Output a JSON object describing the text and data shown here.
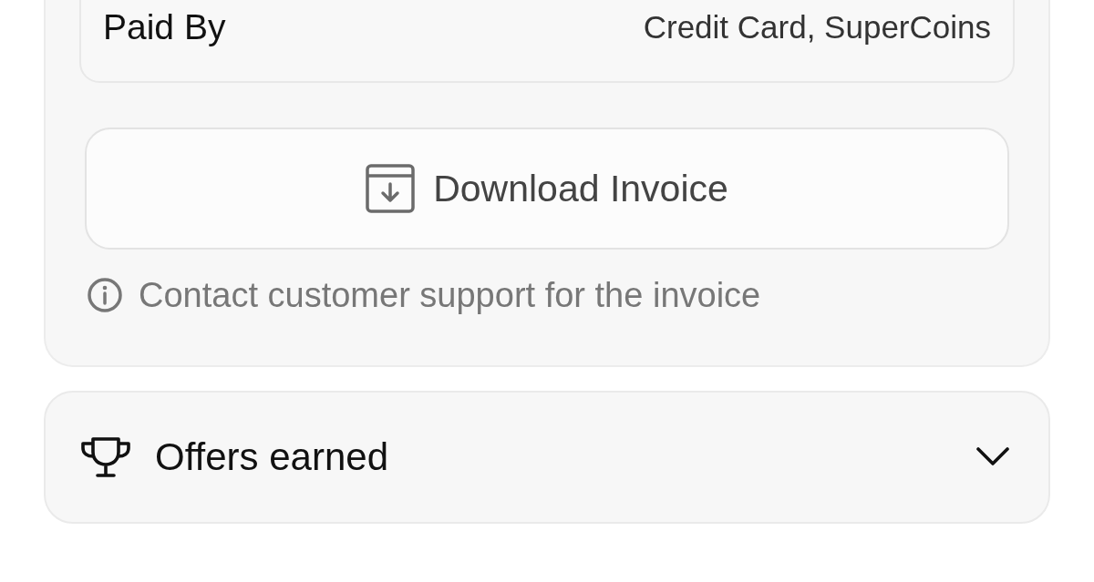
{
  "payment": {
    "label": "Paid By",
    "value": "Credit Card, SuperCoins"
  },
  "invoice": {
    "button": "Download Invoice",
    "note": "Contact customer support for the invoice"
  },
  "offers": {
    "title": "Offers earned",
    "expanded": false
  }
}
